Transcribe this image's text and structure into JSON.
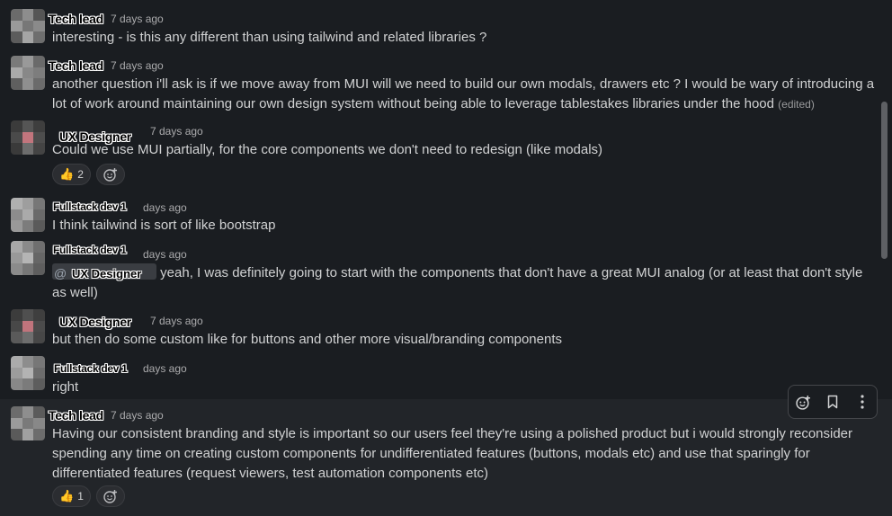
{
  "messages": [
    {
      "name": "Tech lead",
      "time": "7 days ago",
      "text": "interesting - is this any different than using tailwind and related libraries ?"
    },
    {
      "name": "Tech lead",
      "time": "7 days ago",
      "text": "another question i'll ask is if we move away from MUI will we need to build our own modals, drawers etc ? I would be wary of introducing a lot of work around maintaining our own design system without being able to leverage tablestakes libraries under the hood",
      "edited": "(edited)"
    },
    {
      "name": "UX Designer",
      "time": "7 days ago",
      "text": "Could we use MUI partially, for the core components we don't need to redesign (like modals)",
      "reaction_count": "2"
    },
    {
      "name": "Fullstack dev 1",
      "time": "days ago",
      "text": "I think tailwind is sort of like bootstrap"
    },
    {
      "name": "Fullstack dev 1",
      "time": "days ago",
      "mention_at": "@",
      "mention_name": "UX Designer",
      "text": "yeah, I was definitely going to start with the components that don't have a great MUI analog (or at least that don't style as well)"
    },
    {
      "name": "UX Designer",
      "time": "7 days ago",
      "text": "but then do some custom like for buttons and other more visual/branding components"
    },
    {
      "name": "Fullstack dev 1",
      "time": "days ago",
      "text": "right"
    },
    {
      "name": "Tech lead",
      "time": "7 days ago",
      "text": "Having our consistent branding and style is important so our users feel they're using a polished product but i would strongly reconsider spending any time on creating custom components for undifferentiated features (buttons, modals etc) and use that sparingly for differentiated features (request viewers, test automation components etc)",
      "reaction_count": "1"
    }
  ],
  "icons": {
    "reaction_emoji": "thumbs-up-icon",
    "add_reaction": "add-reaction-icon",
    "toolbar": [
      "add-reaction-icon",
      "bookmark-icon",
      "more-vertical-icon"
    ]
  },
  "colors": {
    "background": "#1a1d21",
    "hover_background": "#222529",
    "text": "#d1d2d3",
    "muted": "#ababad"
  }
}
